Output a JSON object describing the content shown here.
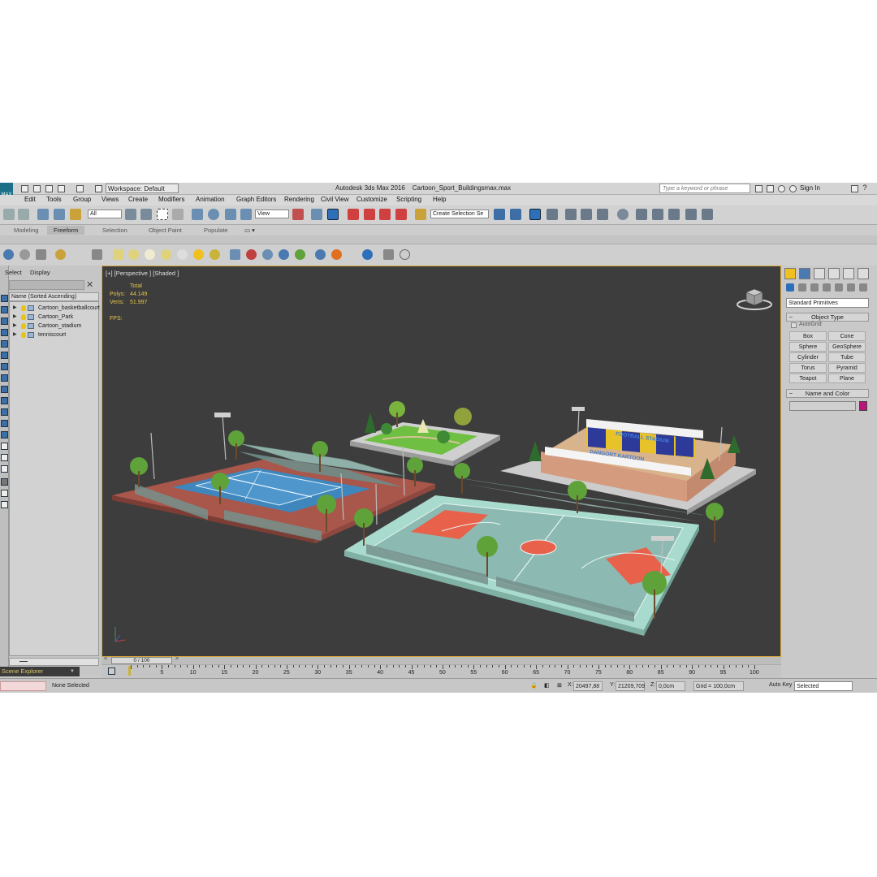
{
  "titlebar": {
    "workspace": "Workspace: Default",
    "app_name": "Autodesk 3ds Max 2016",
    "file_name": "Cartoon_Sport_Buildingsmax.max",
    "search_placeholder": "Type a keyword or phrase",
    "sign_in": "Sign In",
    "logo_label": "MAX"
  },
  "menu": [
    "Edit",
    "Tools",
    "Group",
    "Views",
    "Create",
    "Modifiers",
    "Animation",
    "Graph Editors",
    "Rendering",
    "Civil View",
    "Customize",
    "Scripting",
    "Help"
  ],
  "maintoolbar": {
    "filter": "All",
    "refcoord": "View",
    "selection_set": "Create Selection Se"
  },
  "ribbon_tabs": [
    "Modeling",
    "Freeform",
    "Selection",
    "Object Paint",
    "Populate"
  ],
  "explorer": {
    "tabs": [
      "Select",
      "Display"
    ],
    "column_header": "Name (Sorted Ascending)",
    "items": [
      "Cartoon_basketballcourt",
      "Cartoon_Park",
      "Cartoon_stadium",
      "tenniscourt"
    ],
    "footer_title": "Scene Explorer"
  },
  "viewport": {
    "label": "[+] [Perspective ] [Shaded ]",
    "stats_total": "Total",
    "polys_label": "Polys:",
    "polys_value": "44.149",
    "verts_label": "Verts:",
    "verts_value": "51.997",
    "fps_label": "FPS:",
    "stadium_sign_top": "FOOTBALL STADIUM",
    "stadium_sign_bottom": "DANGORT KARTOON"
  },
  "timeline": {
    "frame_display": "0 / 100",
    "ticks": [
      "5",
      "10",
      "15",
      "20",
      "25",
      "30",
      "35",
      "40",
      "45",
      "50",
      "55",
      "60",
      "65",
      "70",
      "75",
      "80",
      "85",
      "90",
      "95",
      "100"
    ]
  },
  "status": {
    "selection": "None Selected",
    "x_label": "X:",
    "x_value": "20497,88",
    "y_label": "Y:",
    "y_value": "21209,709",
    "z_label": "Z:",
    "z_value": "0,0cm",
    "grid": "Grid = 100,0cm",
    "autokey": "Auto Key",
    "key_mode": "Selected"
  },
  "command_panel": {
    "category": "Standard Primitives",
    "object_type_title": "Object Type",
    "autogrid": "AutoGrid",
    "primitives": [
      "Box",
      "Cone",
      "Sphere",
      "GeoSphere",
      "Cylinder",
      "Tube",
      "Torus",
      "Pyramid",
      "Teapot",
      "Plane"
    ],
    "name_color_title": "Name and Color",
    "object_color": "#b9167c"
  },
  "colors": {
    "viewport_bg": "#3d3d3d",
    "viewport_border": "#d6a73a",
    "stats_text": "#e5c54b",
    "court_blue": "#4d8fbf",
    "court_clay": "#b0574a",
    "basketball_floor": "#9ed0c2",
    "basketball_key": "#e56f5c",
    "tree_green": "#5fa23a",
    "stadium_seat_blue": "#2d3a9a",
    "stadium_seat_yellow": "#e8c229"
  }
}
